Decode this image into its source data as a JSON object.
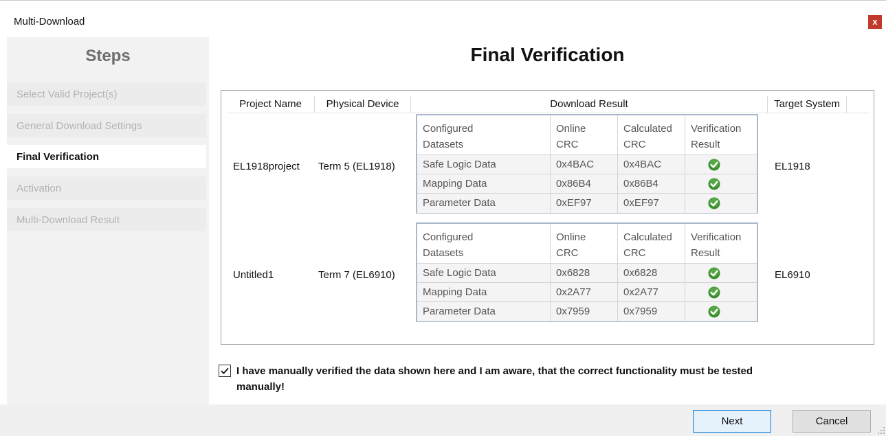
{
  "window": {
    "title": "Multi-Download",
    "close_label": "x"
  },
  "sidebar": {
    "title": "Steps",
    "items": [
      {
        "label": "Select Valid Project(s)",
        "active": false
      },
      {
        "label": "General Download Settings",
        "active": false
      },
      {
        "label": "Final Verification",
        "active": true
      },
      {
        "label": "Activation",
        "active": false
      },
      {
        "label": "Multi-Download Result",
        "active": false
      }
    ]
  },
  "main": {
    "title": "Final Verification"
  },
  "table": {
    "headers": [
      "Project Name",
      "Physical Device",
      "Download Result",
      "Target System"
    ],
    "inner_headers": {
      "configured_1": "Configured",
      "configured_2": "Datasets",
      "online_1": "Online",
      "online_2": "CRC",
      "calculated_1": "Calculated",
      "calculated_2": "CRC",
      "verification_1": "Verification",
      "verification_2": "Result"
    },
    "projects": [
      {
        "name": "EL1918project",
        "device": "Term 5 (EL1918)",
        "target": "EL1918",
        "datasets": [
          {
            "name": "Safe Logic Data",
            "online": "0x4BAC",
            "calculated": "0x4BAC",
            "verified": true
          },
          {
            "name": "Mapping Data",
            "online": "0x86B4",
            "calculated": "0x86B4",
            "verified": true
          },
          {
            "name": "Parameter Data",
            "online": "0xEF97",
            "calculated": "0xEF97",
            "verified": true
          }
        ]
      },
      {
        "name": "Untitled1",
        "device": "Term 7 (EL6910)",
        "target": "EL6910",
        "datasets": [
          {
            "name": "Safe Logic Data",
            "online": "0x6828",
            "calculated": "0x6828",
            "verified": true
          },
          {
            "name": "Mapping Data",
            "online": "0x2A77",
            "calculated": "0x2A77",
            "verified": true
          },
          {
            "name": "Parameter Data",
            "online": "0x7959",
            "calculated": "0x7959",
            "verified": true
          }
        ]
      }
    ]
  },
  "confirmation": {
    "checked": true,
    "text_line1": "I have manually verified the data shown here and I am aware, that the correct functionality must be tested",
    "text_line2": "manually!"
  },
  "buttons": {
    "next": "Next",
    "cancel": "Cancel"
  },
  "colors": {
    "check_green": "#3c8d2f",
    "close_red": "#c0392b",
    "inner_border": "#a9b9cb"
  },
  "icons": {
    "verified": "check-circle-icon"
  }
}
